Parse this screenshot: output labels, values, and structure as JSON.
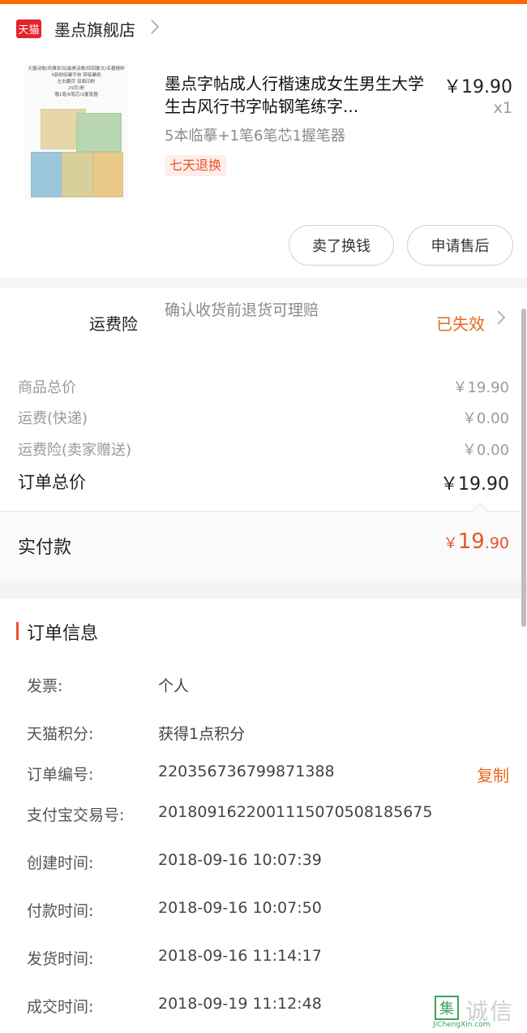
{
  "colors": {
    "accent": "#ff6a00",
    "tmall_red": "#e3242b",
    "status_orange": "#e56a1c",
    "price_orange": "#e8542a"
  },
  "store": {
    "badge": "天猫",
    "name": "墨点旗舰店",
    "chevron_icon": "chevron-right-icon"
  },
  "product": {
    "thumbnail_text": "大唐诗歌/风雅宋词/最美诗歌/回回散文/名著精粹\n5新财临摹字帖 带临摹纸\n左右翻页 双面印刷\n29页/册\n赠1笔/6笔芯/1握笔器",
    "title": "墨点字帖成人行楷速成女生男生大学生古风行书字帖钢笔练字...",
    "sku": "5本临摹+1笔6笔芯1握笔器",
    "return_tag": "七天退换",
    "price": "￥19.90",
    "quantity": "x1"
  },
  "actions": {
    "sell": "卖了换钱",
    "after_sale": "申请售后"
  },
  "shipping_insurance": {
    "label": "运费险",
    "description": "确认收货前退货可理赔",
    "status": "已失效"
  },
  "price_breakdown": {
    "goods_total": {
      "label": "商品总价",
      "value": "￥19.90"
    },
    "shipping": {
      "label": "运费(快递)",
      "value": "￥0.00"
    },
    "insurance": {
      "label": "运费险(卖家赠送)",
      "value": "￥0.00"
    },
    "order_total": {
      "label": "订单总价",
      "value": "￥19.90"
    }
  },
  "paid": {
    "label": "实付款",
    "currency": "￥",
    "integer": "19",
    "decimal": ".90"
  },
  "order_info": {
    "title": "订单信息",
    "invoice": {
      "key": "发票:",
      "value": "个人"
    },
    "points": {
      "key": "天猫积分:",
      "value": "获得1点积分"
    },
    "order_no": {
      "key": "订单编号:",
      "value": "220356736799871388",
      "copy": "复制"
    },
    "alipay_no": {
      "key": "支付宝交易号:",
      "value": "2018091622001115070508185675"
    },
    "created": {
      "key": "创建时间:",
      "value": "2018-09-16 10:07:39"
    },
    "paid_time": {
      "key": "付款时间:",
      "value": "2018-09-16 10:07:50"
    },
    "shipped": {
      "key": "发货时间:",
      "value": "2018-09-16 11:14:17"
    },
    "completed": {
      "key": "成交时间:",
      "value": "2018-09-19 11:12:48"
    }
  },
  "watermark": {
    "glyph": "集",
    "text": "诚信",
    "url": "JiChengXin.com"
  }
}
